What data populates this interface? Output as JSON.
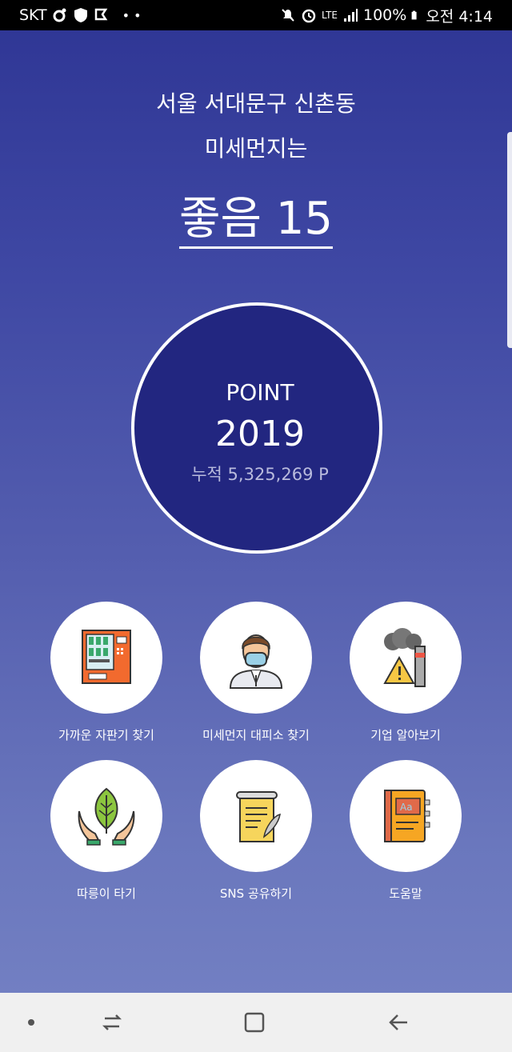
{
  "status_bar": {
    "carrier": "SKT",
    "network": "LTE",
    "battery": "100%",
    "time": "오전 4:14"
  },
  "header": {
    "location": "서울 서대문구 신촌동",
    "subtitle": "미세먼지는",
    "status": "좋음 15"
  },
  "point": {
    "label": "POINT",
    "value": "2019",
    "total": "누적 5,325,269 P"
  },
  "menu": [
    {
      "label": "가까운 자판기 찾기",
      "icon": "vending-machine-icon"
    },
    {
      "label": "미세먼지 대피소 찾기",
      "icon": "masked-person-icon"
    },
    {
      "label": "기업 알아보기",
      "icon": "factory-warning-icon"
    },
    {
      "label": "따릉이 타기",
      "icon": "leaf-hands-icon"
    },
    {
      "label": "SNS 공유하기",
      "icon": "scroll-quill-icon"
    },
    {
      "label": "도움말",
      "icon": "help-book-icon"
    }
  ],
  "colors": {
    "background_top": "#2e3594",
    "background_bottom": "#7582c4",
    "circle": "#222680"
  }
}
